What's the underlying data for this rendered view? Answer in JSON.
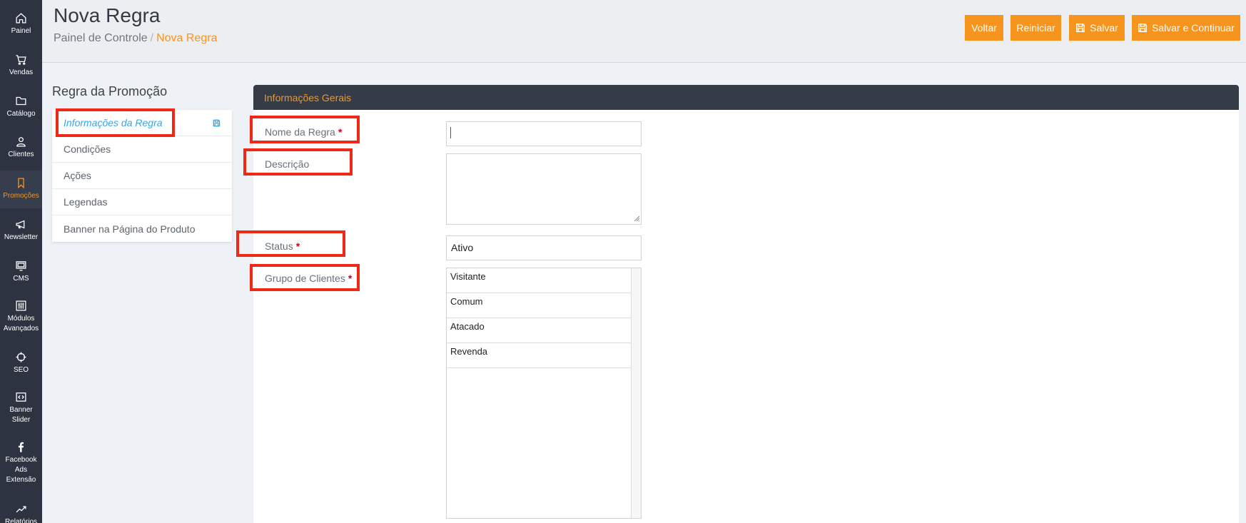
{
  "sidebar": {
    "items": [
      {
        "label": "Painel",
        "icon": "home-icon"
      },
      {
        "label": "Vendas",
        "icon": "cart-icon"
      },
      {
        "label": "Catálogo",
        "icon": "folder-icon"
      },
      {
        "label": "Clientes",
        "icon": "user-icon"
      },
      {
        "label": "Promoções",
        "icon": "bookmark-icon",
        "active": true
      },
      {
        "label": "Newsletter",
        "icon": "megaphone-icon"
      },
      {
        "label": "CMS",
        "icon": "monitor-icon"
      },
      {
        "label": "Módulos\nAvançados",
        "icon": "sliders-icon"
      },
      {
        "label": "SEO",
        "icon": "crosshair-icon"
      },
      {
        "label": "Banner\nSlider",
        "icon": "code-icon"
      },
      {
        "label": "Facebook\nAds\nExtensão",
        "icon": "facebook-icon"
      },
      {
        "label": "Relatórios",
        "icon": "chart-icon"
      }
    ]
  },
  "header": {
    "title": "Nova Regra",
    "breadcrumb": {
      "root": "Painel de Controle",
      "separator": "/",
      "current": "Nova Regra"
    },
    "buttons": {
      "back": "Voltar",
      "reset": "Reiniciar",
      "save": "Salvar",
      "save_continue": "Salvar e Continuar"
    }
  },
  "rule_nav": {
    "title": "Regra da Promoção",
    "items": [
      {
        "label": "Informações da Regra",
        "active": true
      },
      {
        "label": "Condições"
      },
      {
        "label": "Ações"
      },
      {
        "label": "Legendas"
      },
      {
        "label": "Banner na Página do Produto"
      }
    ]
  },
  "form": {
    "section_title": "Informações Gerais",
    "fields": {
      "name": {
        "label": "Nome da Regra",
        "value": ""
      },
      "description": {
        "label": "Descrição",
        "value": ""
      },
      "status": {
        "label": "Status",
        "value": "Ativo"
      },
      "customer_groups": {
        "label": "Grupo de Clientes",
        "options": [
          "Visitante",
          "Comum",
          "Atacado",
          "Revenda"
        ]
      }
    },
    "required_mark": "*"
  },
  "colors": {
    "accent": "#f7941d",
    "sidebar_bg": "#2d3340",
    "panel_header_bg": "#363c47",
    "link": "#3aa6dc",
    "annotation": "#ee2a17",
    "required": "#d0021b"
  }
}
